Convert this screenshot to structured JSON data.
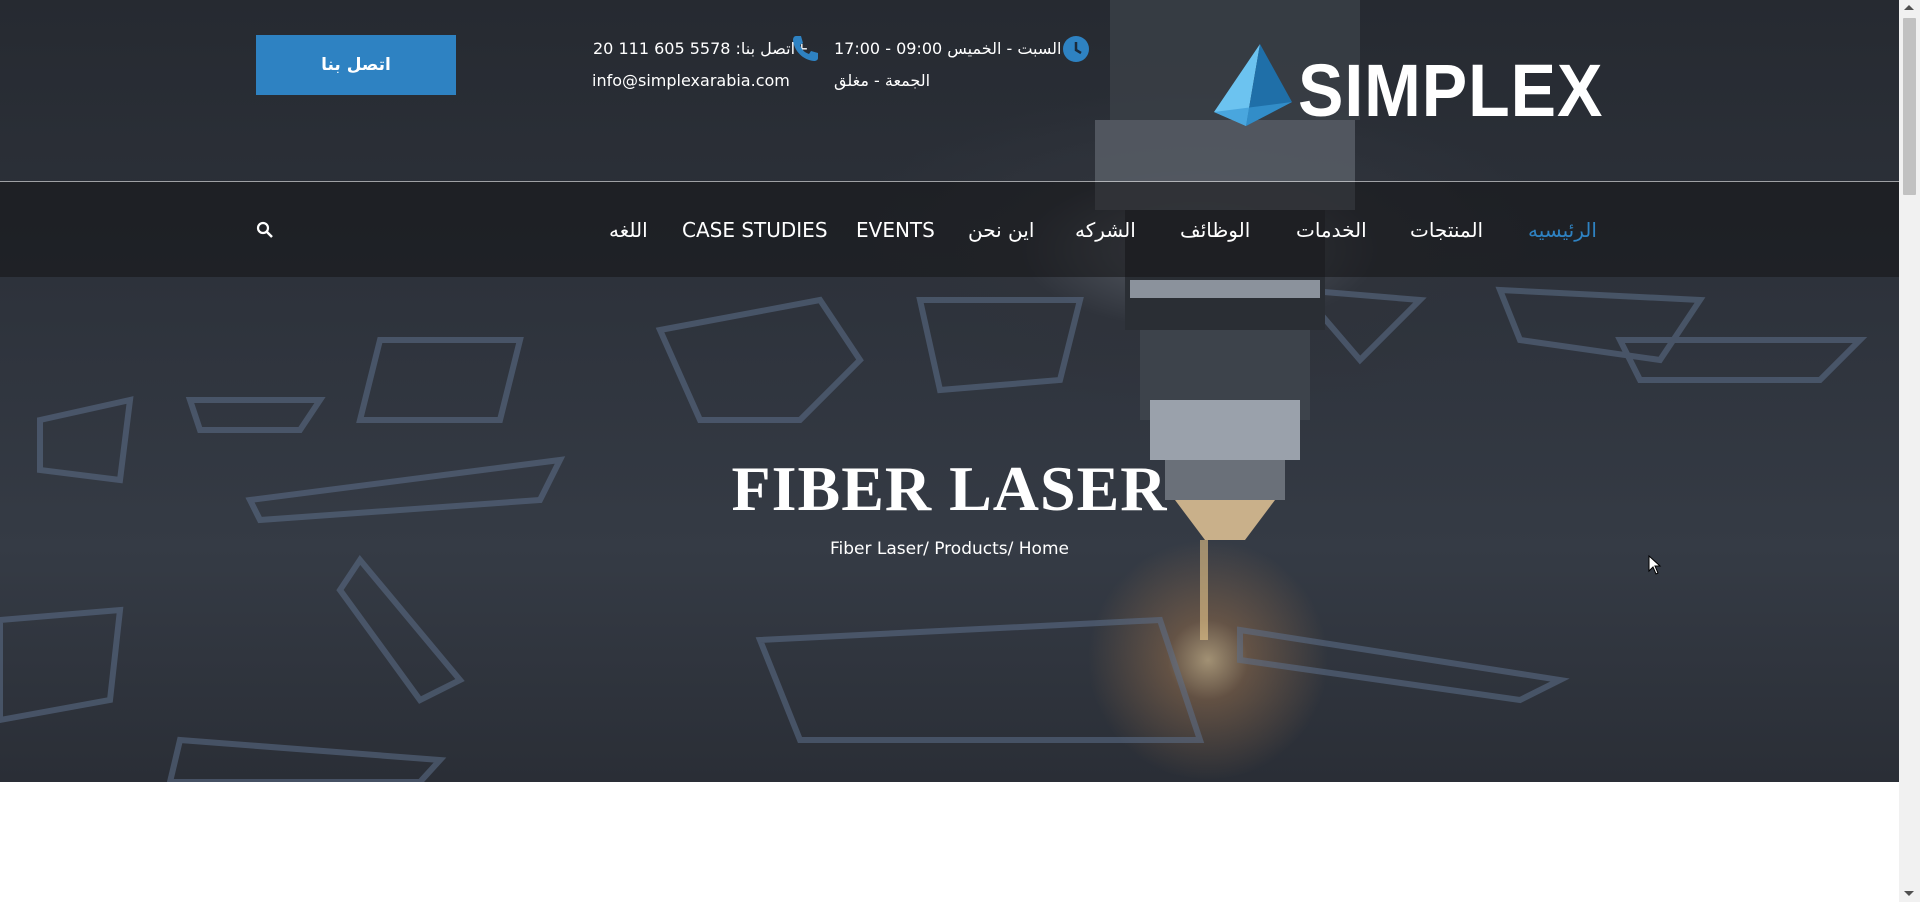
{
  "header": {
    "cta_label": "اتصل بنا",
    "phone_text": "اتصل بنا: 5578 605 111 20+",
    "email": "info@simplexarabia.com",
    "hours_line1": "السبت - الخميس 09:00 - 17:00",
    "hours_line2": "الجمعة - مغلق",
    "logo_text": "SIMPLEX"
  },
  "nav": {
    "items": [
      {
        "label": "الرئيسيه",
        "active": true
      },
      {
        "label": "المنتجات"
      },
      {
        "label": "الخدمات"
      },
      {
        "label": "الوظائف"
      },
      {
        "label": "الشركه"
      },
      {
        "label": "اين نحن"
      },
      {
        "label": "EVENTS"
      },
      {
        "label": "CASE STUDIES"
      },
      {
        "label": "اللغه"
      }
    ],
    "search_icon": "search-icon"
  },
  "hero": {
    "title": "FIBER LASER",
    "breadcrumb": "Fiber Laser/ Products/ Home"
  },
  "colors": {
    "accent": "#2e82c2",
    "hero_dark": "#2b2f37"
  },
  "icons": {
    "phone": "phone-icon",
    "clock": "clock-icon",
    "logo": "pyramid-logo-icon",
    "cursor": "mouse-cursor-icon"
  }
}
